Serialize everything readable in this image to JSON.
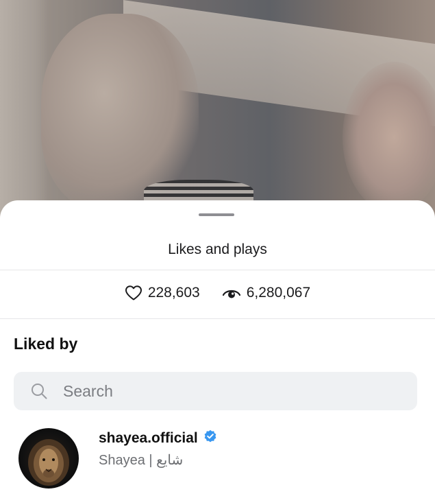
{
  "sheet": {
    "title": "Likes and plays"
  },
  "stats": {
    "likes": "228,603",
    "likes_icon": "heart-outline-icon",
    "plays": "6,280,067",
    "plays_icon": "eye-icon"
  },
  "liked_by": {
    "heading": "Liked by",
    "search": {
      "placeholder": "Search",
      "value": ""
    },
    "users": [
      {
        "username": "shayea.official",
        "verified": true,
        "full_name": "Shayea | شایع"
      }
    ]
  },
  "colors": {
    "verified_badge": "#3897f0",
    "search_bg": "#eff1f3",
    "secondary_text": "#6c6e72"
  }
}
